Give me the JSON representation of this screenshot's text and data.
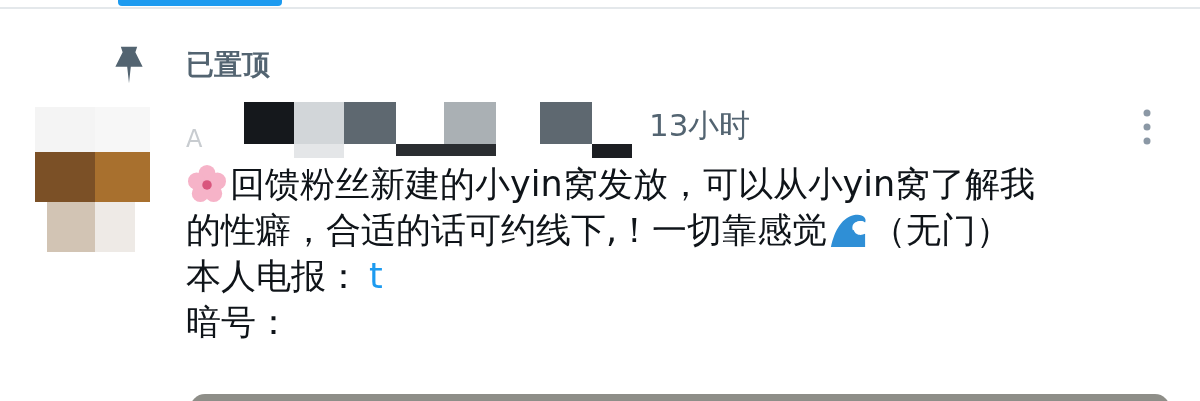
{
  "pinned_label": "已置顶",
  "post": {
    "author": "A",
    "time": "13小时",
    "lines": [
      [
        {
          "kind": "flower"
        },
        {
          "kind": "text",
          "text": "回馈粉丝新建的小yin窝发放，可以从小yin窝了解我"
        }
      ],
      [
        {
          "kind": "text",
          "text": "的性癖，合适的话可约线下,！一切靠感觉"
        },
        {
          "kind": "wave"
        },
        {
          "kind": "text",
          "text": "（无门）"
        }
      ],
      [
        {
          "kind": "text",
          "text": "本人电报："
        },
        {
          "kind": "link",
          "text": "t"
        }
      ],
      [
        {
          "kind": "text",
          "text": "暗号："
        }
      ]
    ]
  }
}
